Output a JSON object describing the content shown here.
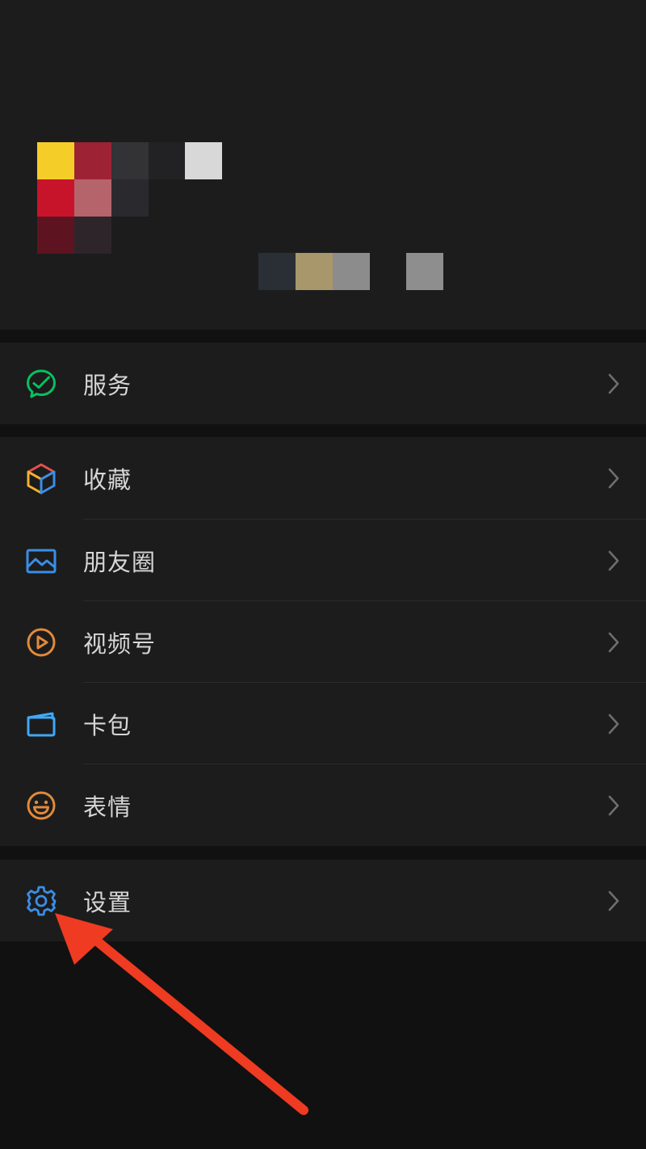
{
  "colors": {
    "background": "#111111",
    "card": "#1c1c1c",
    "text": "#d6d6d6",
    "chevron": "#6e6e6e",
    "service_green": "#07c160",
    "moments_blue": "#3a8ee6",
    "channels_orange": "#e08a3c",
    "settings_blue": "#3a8ee6",
    "annotation_red": "#ee3b22"
  },
  "profile": {
    "avatar_mosaic": [
      "#f5cd28",
      "#9d2233",
      "#333235",
      "#222224",
      "#d8d8d8",
      "#c8142b",
      "#b5646b",
      "#2a2a2e",
      "#5e1420",
      "#2d252a"
    ],
    "id_mosaic": [
      "#2a2f36",
      "#a8976a",
      "#8c8c8c",
      "#8e8e8e"
    ]
  },
  "menu": {
    "services": {
      "label": "服务",
      "icon": "services-icon"
    },
    "favorites": {
      "label": "收藏",
      "icon": "cube-icon"
    },
    "moments": {
      "label": "朋友圈",
      "icon": "image-icon"
    },
    "channels": {
      "label": "视频号",
      "icon": "play-circle-icon"
    },
    "cards": {
      "label": "卡包",
      "icon": "wallet-icon"
    },
    "stickers": {
      "label": "表情",
      "icon": "smile-icon"
    },
    "settings": {
      "label": "设置",
      "icon": "gear-icon"
    }
  },
  "annotation": {
    "type": "arrow",
    "target": "settings",
    "color": "#ee3b22"
  }
}
